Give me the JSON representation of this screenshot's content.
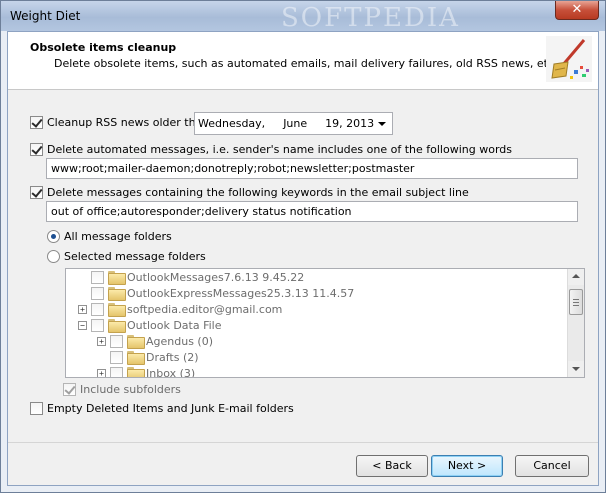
{
  "window": {
    "title": "Weight Diet",
    "close_glyph": "✕",
    "watermark": "SOFTPEDIA"
  },
  "header": {
    "title": "Obsolete items cleanup",
    "description": "Delete obsolete items, such as automated emails, mail delivery failures, old RSS news, etc",
    "icon": "broom-cleanup-icon"
  },
  "rss": {
    "checked": true,
    "label": "Cleanup RSS news older than",
    "date_weekday": "Wednesday,",
    "date_month": "June",
    "date_day_year": "19, 2013"
  },
  "senders": {
    "checked": true,
    "label": "Delete automated messages, i.e. sender's name includes one of the following words",
    "value": "www;root;mailer-daemon;donotreply;robot;newsletter;postmaster"
  },
  "keywords": {
    "checked": true,
    "label": "Delete messages containing the following keywords in the email subject line",
    "value": "out of office;autoresponder;delivery status notification"
  },
  "folders": {
    "all_label": "All message folders",
    "selected_label": "Selected message folders",
    "selected_mode": "all",
    "tree": [
      {
        "label": "OutlookMessages7.6.13 9.45.22",
        "level": 0,
        "expander": ""
      },
      {
        "label": "OutlookExpressMessages25.3.13 11.4.57",
        "level": 0,
        "expander": ""
      },
      {
        "label": "softpedia.editor@gmail.com",
        "level": 0,
        "expander": "+"
      },
      {
        "label": "Outlook Data File",
        "level": 0,
        "expander": "−"
      },
      {
        "label": "Agendus (0)",
        "level": 1,
        "expander": "+"
      },
      {
        "label": "Drafts (2)",
        "level": 1,
        "expander": ""
      },
      {
        "label": "Inbox (3)",
        "level": 1,
        "expander": "+"
      }
    ],
    "include_subfolders_label": "Include subfolders",
    "include_subfolders_checked": true
  },
  "empty_deleted": {
    "checked": false,
    "label": "Empty Deleted Items and Junk E-mail folders"
  },
  "buttons": {
    "back": "< Back",
    "next": "Next >",
    "cancel": "Cancel"
  }
}
